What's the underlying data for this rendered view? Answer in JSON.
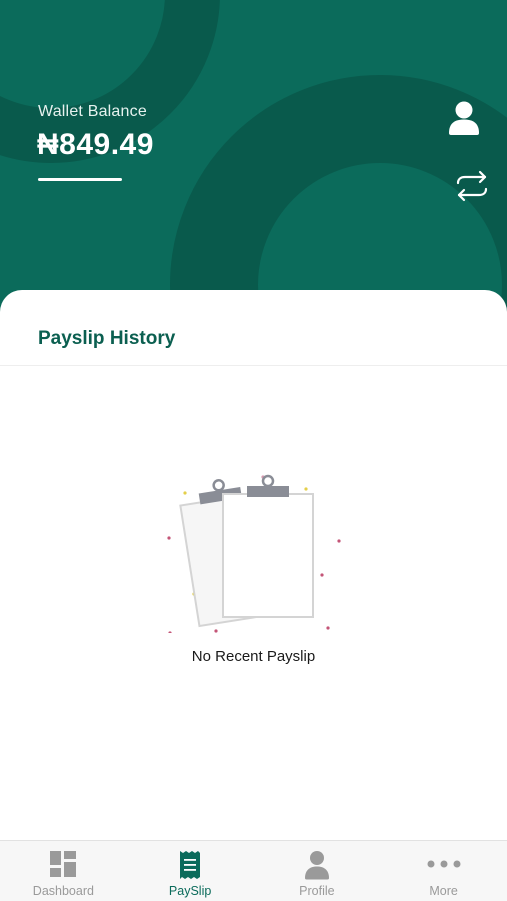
{
  "wallet": {
    "label": "Wallet Balance",
    "amount": "₦849.49"
  },
  "header": {
    "profile_icon": "user-icon",
    "transfer_icon": "swap-arrows-icon"
  },
  "payslip": {
    "title": "Payslip History",
    "empty_message": "No Recent Payslip",
    "empty_icon": "clipboard-icon"
  },
  "nav": {
    "active": "PaySlip",
    "items": [
      {
        "label": "Dashboard",
        "icon": "dashboard-icon"
      },
      {
        "label": "PaySlip",
        "icon": "receipt-icon"
      },
      {
        "label": "Profile",
        "icon": "user-icon"
      },
      {
        "label": "More",
        "icon": "more-dots-icon"
      }
    ]
  },
  "colors": {
    "primary": "#0b6b5b",
    "primary_dark": "#095a4c",
    "nav_inactive": "#9a9a9a"
  }
}
